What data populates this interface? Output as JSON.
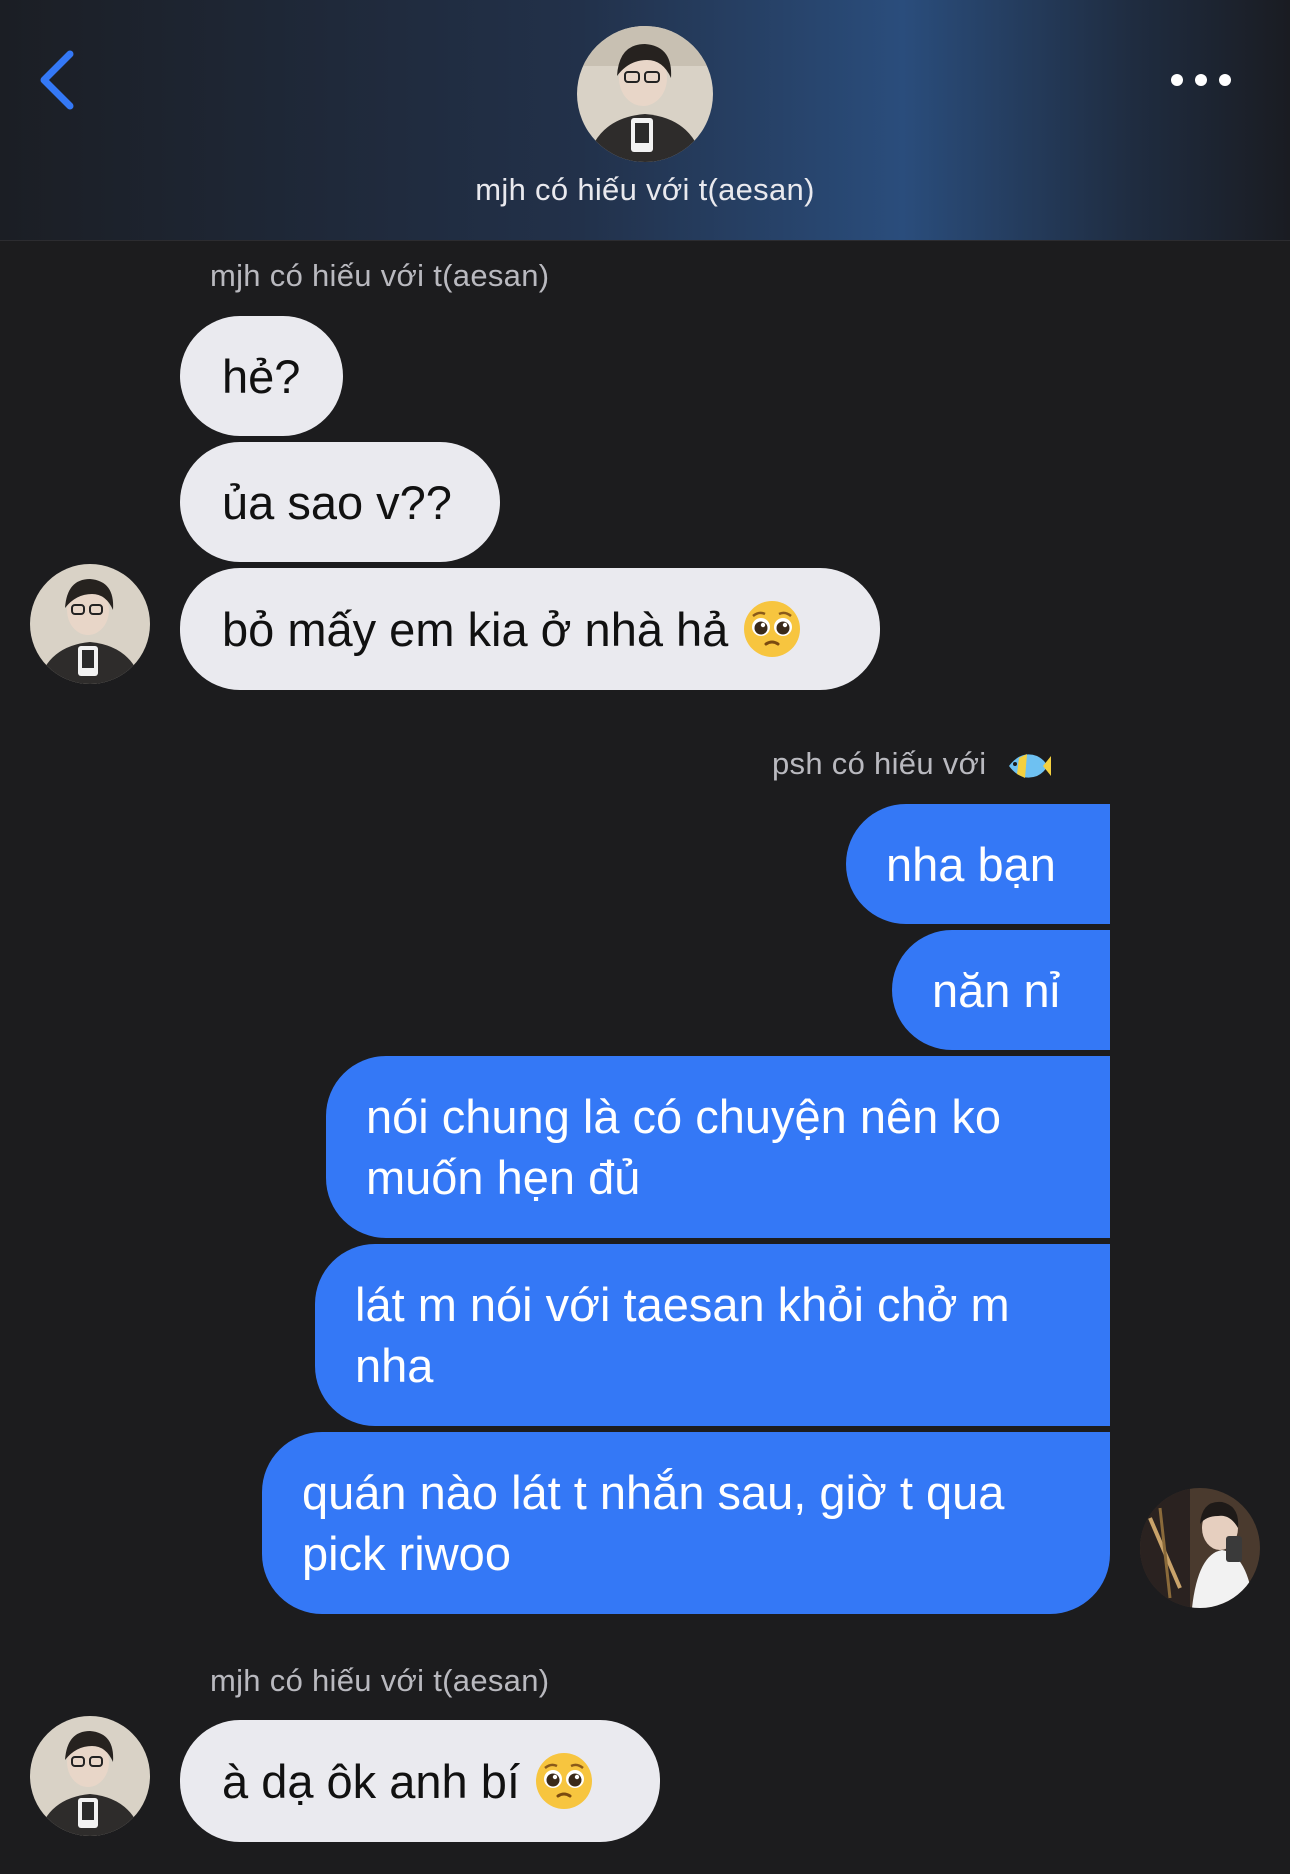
{
  "header": {
    "back_icon": "chevron-left-icon",
    "more_icon": "ellipsis-icon",
    "title": "mjh có hiếu với t(aesan)",
    "accent": "#3478f6"
  },
  "messages": {
    "group1_sender": "mjh có hiếu với t(aesan)",
    "m1": "hẻ?",
    "m2": "ủa sao v??",
    "m3": "bỏ mấy em kia ở nhà hả",
    "group2_sender": "psh có hiếu với",
    "m4": "nha bạn",
    "m5": "năn nỉ",
    "m6_line1": "nói chung là có chuyện nên ko",
    "m6_line2": "muốn hẹn đủ",
    "m7_line1": "lát m nói với taesan khỏi chở m",
    "m7_line2": "nha",
    "m8_line1": "quán nào lát t nhắn sau, giờ t qua",
    "m8_line2": "pick riwoo",
    "group3_sender": "mjh có hiếu với t(aesan)",
    "m9": "à dạ ôk anh bí"
  },
  "colors": {
    "background": "#1c1c1e",
    "incoming_bubble": "#eaeaef",
    "outgoing_bubble": "#3478f6"
  }
}
